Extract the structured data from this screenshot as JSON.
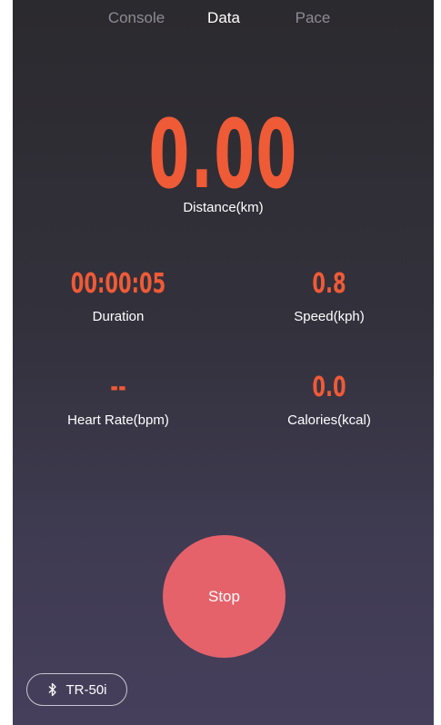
{
  "tabs": [
    {
      "label": "Console",
      "active": false
    },
    {
      "label": "Data",
      "active": true
    },
    {
      "label": "Pace",
      "active": false
    }
  ],
  "distance": {
    "value": "0.00",
    "label": "Distance(km)"
  },
  "metrics": {
    "duration": {
      "value": "00:00:05",
      "label": "Duration"
    },
    "speed": {
      "value": "0.8",
      "label": "Speed(kph)"
    },
    "heart_rate": {
      "value": "--",
      "label": "Heart Rate(bpm)"
    },
    "calories": {
      "value": "0.0",
      "label": "Calories(kcal)"
    }
  },
  "stop_button": {
    "label": "Stop"
  },
  "device": {
    "name": "TR-50i",
    "icon": "bluetooth-icon"
  },
  "colors": {
    "accent": "#ef5a37",
    "stop": "#e5626b",
    "tab_inactive": "#8d8b94"
  }
}
